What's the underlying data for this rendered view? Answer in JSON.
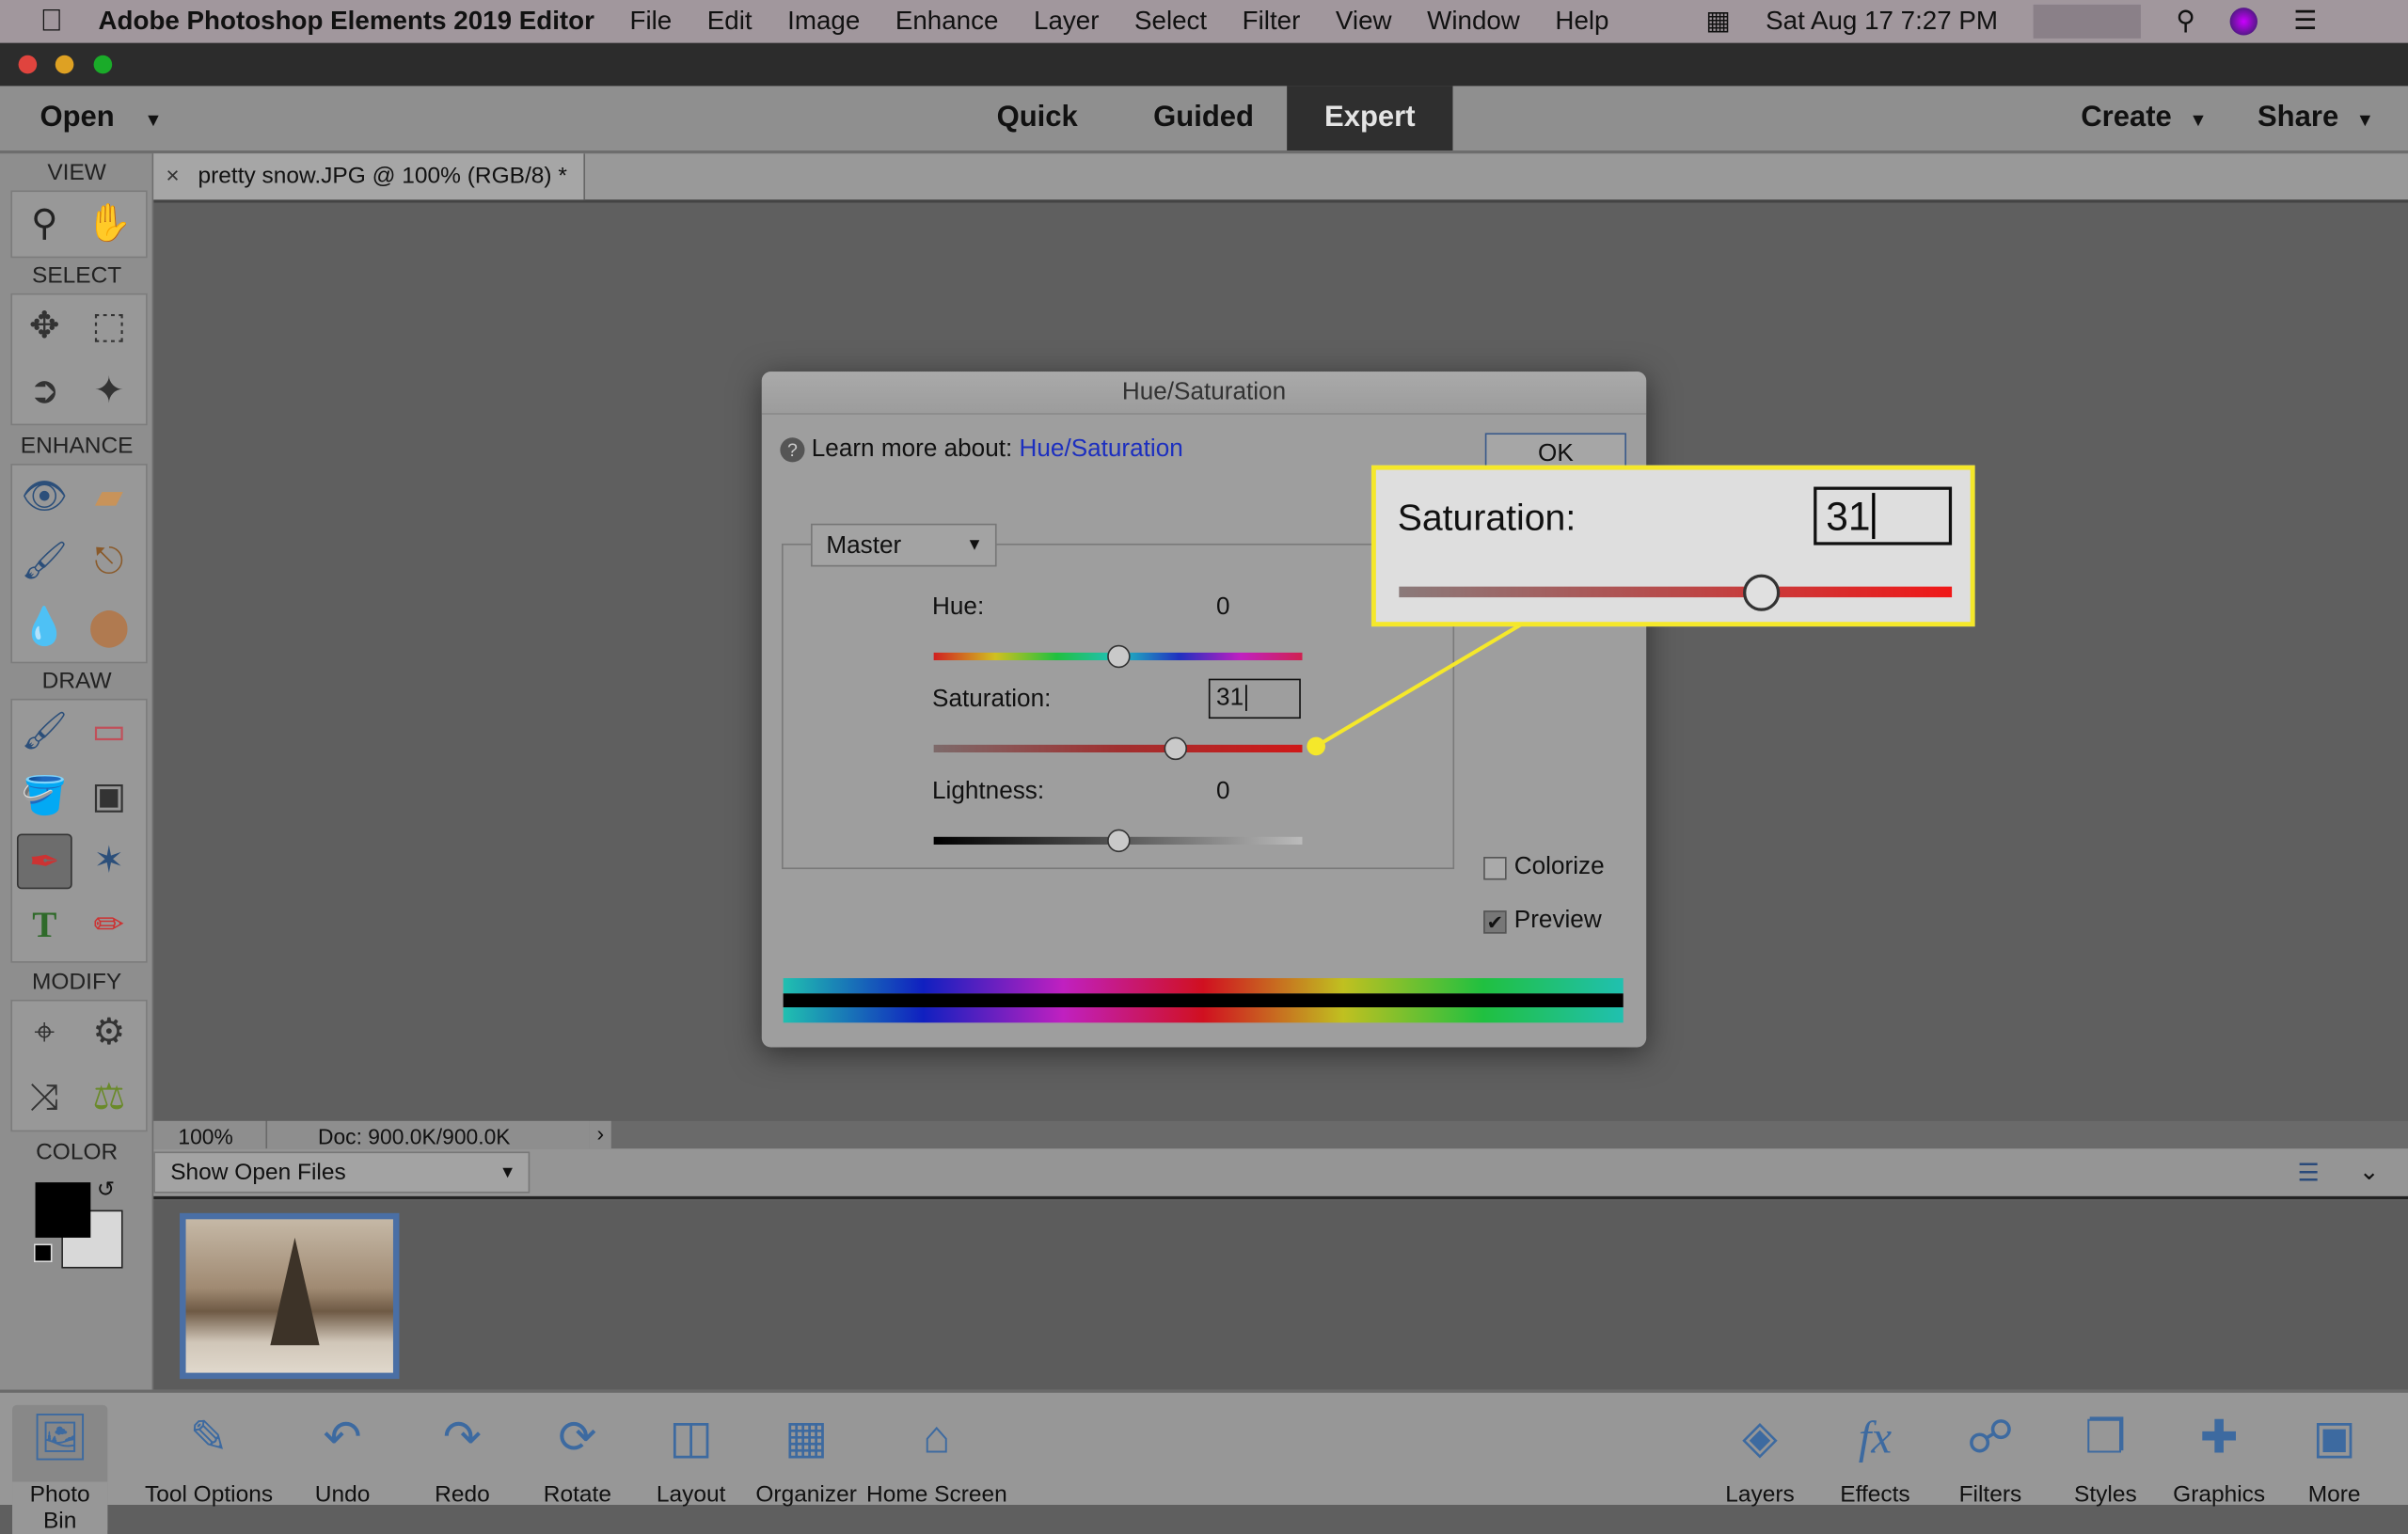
{
  "menubar": {
    "app": "Adobe Photoshop Elements 2019 Editor",
    "items": [
      "File",
      "Edit",
      "Image",
      "Enhance",
      "Layer",
      "Select",
      "Filter",
      "View",
      "Window",
      "Help"
    ],
    "clock": "Sat Aug 17  7:27 PM"
  },
  "modebar": {
    "open": "Open",
    "modes": [
      "Quick",
      "Guided",
      "Expert"
    ],
    "active_mode": "Expert",
    "create": "Create",
    "share": "Share"
  },
  "toolbar": {
    "sections": [
      "VIEW",
      "SELECT",
      "ENHANCE",
      "DRAW",
      "MODIFY",
      "COLOR"
    ]
  },
  "doc_tab": {
    "close": "×",
    "title": "pretty snow.JPG @ 100% (RGB/8) *"
  },
  "status": {
    "zoom": "100%",
    "doc": "Doc: 900.0K/900.0K",
    "arrow": "›"
  },
  "photo_bin": {
    "dropdown": "Show Open Files"
  },
  "taskbar": {
    "left": [
      "Photo Bin",
      "Tool Options",
      "Undo",
      "Redo",
      "Rotate",
      "Layout",
      "Organizer",
      "Home Screen"
    ],
    "right": [
      "Layers",
      "Effects",
      "Filters",
      "Styles",
      "Graphics",
      "More"
    ]
  },
  "dialog": {
    "title": "Hue/Saturation",
    "learn_prefix": "Learn more about:",
    "learn_link": "Hue/Saturation",
    "ok": "OK",
    "channel": "Master",
    "hue_label": "Hue:",
    "hue_value": "0",
    "hue_level": 0,
    "sat_label": "Saturation:",
    "sat_value": "31",
    "sat_level": 31,
    "light_label": "Lightness:",
    "light_value": "0",
    "light_level": 0,
    "colorize": "Colorize",
    "colorize_checked": false,
    "preview": "Preview",
    "preview_checked": true
  },
  "callout": {
    "label": "Saturation:",
    "value": "31",
    "color": "#f5e82a"
  }
}
